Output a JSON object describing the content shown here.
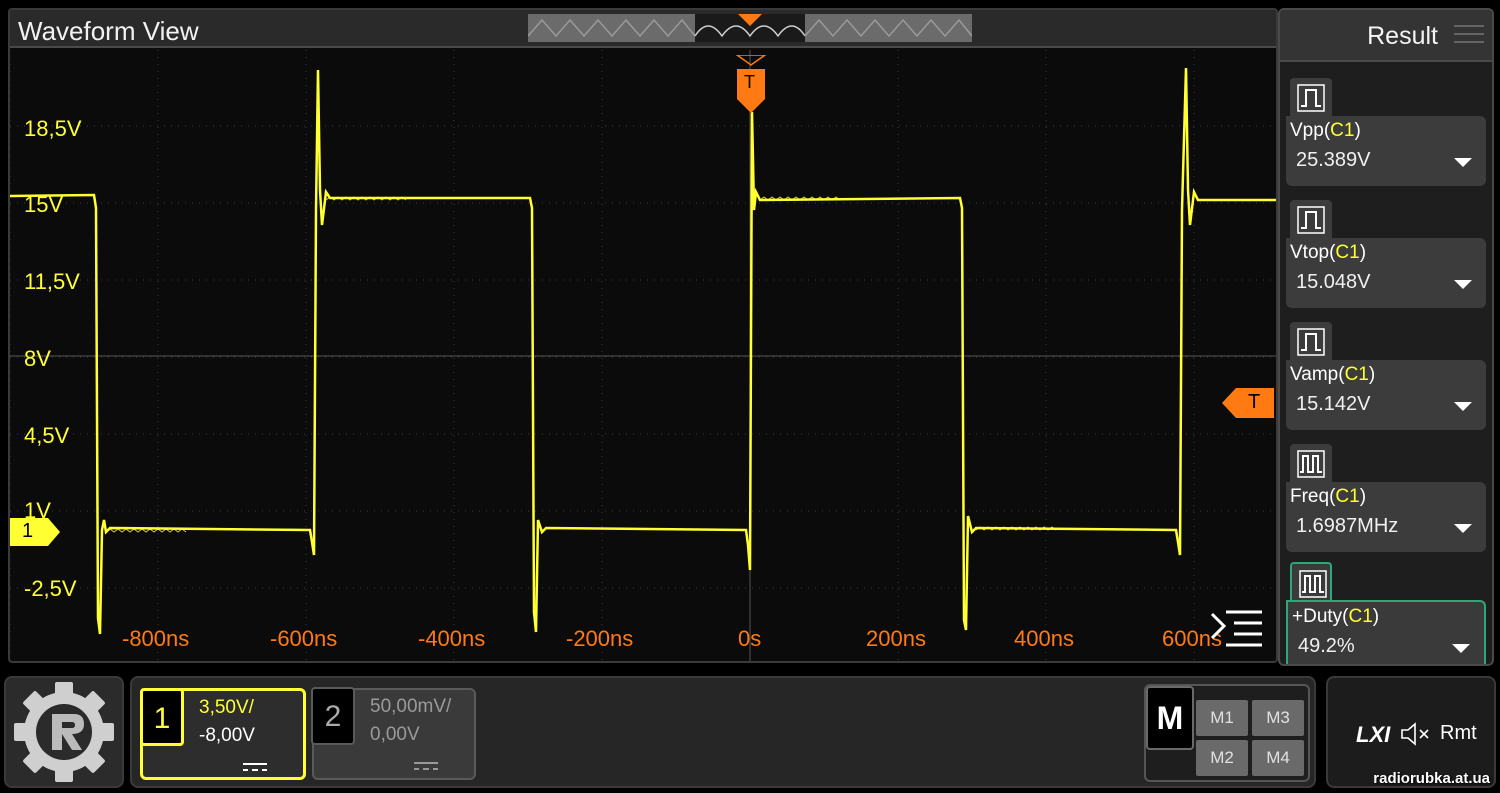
{
  "waveform": {
    "title": "Waveform View",
    "volt_labels": [
      "18,5V",
      "15V",
      "11,5V",
      "8V",
      "4,5V",
      "1V",
      "-2,5V"
    ],
    "time_labels": [
      "-800ns",
      "-600ns",
      "-400ns",
      "-200ns",
      "0s",
      "200ns",
      "400ns",
      "600ns"
    ],
    "trigger_label": "T",
    "ch1_marker": "1",
    "trace_color": "#ffff33",
    "accent_color": "#ff7a12"
  },
  "result": {
    "title": "Result",
    "measurements": [
      {
        "name": "Vpp",
        "source": "C1",
        "value": "25.389V"
      },
      {
        "name": "Vtop",
        "source": "C1",
        "value": "15.048V"
      },
      {
        "name": "Vamp",
        "source": "C1",
        "value": "15.142V"
      },
      {
        "name": "Freq",
        "source": "C1",
        "value": "1.6987MHz"
      },
      {
        "name": "+Duty",
        "source": "C1",
        "value": "49.2%"
      }
    ]
  },
  "channels": {
    "ch1": {
      "number": "1",
      "scale": "3,50V/",
      "offset": "-8,00V"
    },
    "ch2": {
      "number": "2",
      "scale": "50,00mV/",
      "offset": "0,00V"
    }
  },
  "math": {
    "label": "M",
    "buttons": [
      "M1",
      "M3",
      "M2",
      "M4"
    ]
  },
  "status": {
    "lxi": "LXI",
    "rmt": "Rmt"
  },
  "watermark": "radiorubka.at.ua"
}
